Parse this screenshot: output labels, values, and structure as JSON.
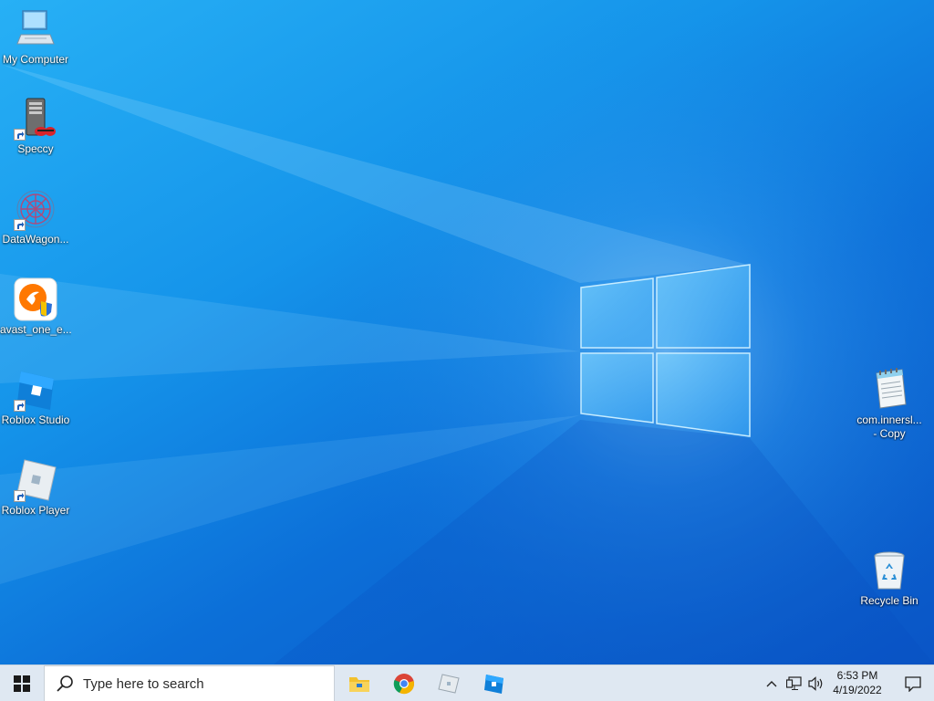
{
  "desktop": {
    "icons_left": [
      {
        "label": "My Computer",
        "icon": "monitor-icon",
        "shortcut": false
      },
      {
        "label": "Speccy",
        "icon": "speccy-icon",
        "shortcut": true
      },
      {
        "label": "DataWagon...",
        "icon": "datawagon-icon",
        "shortcut": true
      },
      {
        "label": "avast_one_e...",
        "icon": "avast-icon",
        "shortcut": false
      },
      {
        "label": "Roblox Studio",
        "icon": "roblox-studio-icon",
        "shortcut": true
      },
      {
        "label": "Roblox Player",
        "icon": "roblox-player-icon",
        "shortcut": true
      }
    ],
    "icons_right": [
      {
        "label": "com.innersl...\n- Copy",
        "icon": "notepad-file-icon",
        "shortcut": false
      },
      {
        "label": "Recycle Bin",
        "icon": "recycle-bin-icon",
        "shortcut": false
      }
    ]
  },
  "taskbar": {
    "search_placeholder": "Type here to search",
    "pinned_apps": [
      "file-explorer-icon",
      "chrome-icon",
      "roblox-player-icon",
      "roblox-studio-icon"
    ],
    "tray": {
      "overflow": "chevron-up-icon",
      "network": "network-icon",
      "volume": "volume-icon",
      "notifications": "notification-icon"
    },
    "clock": {
      "time": "6:53 PM",
      "date": "4/19/2022"
    }
  },
  "colors": {
    "wallpaper_accent": "#1594ea",
    "taskbar_bg": "#dfe8f2"
  }
}
